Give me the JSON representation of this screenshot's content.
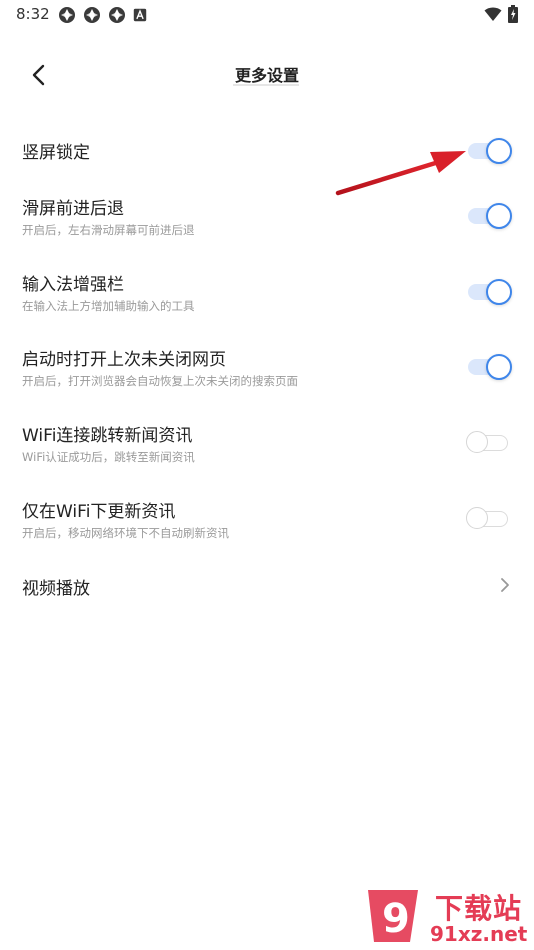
{
  "status_bar": {
    "time": "8:32",
    "notification_icons": [
      "app-notification-icon",
      "app-notification-icon",
      "app-notification-icon",
      "a-notification-icon"
    ],
    "right_icons": [
      "wifi-icon",
      "battery-charging-icon"
    ]
  },
  "header": {
    "title": "更多设置",
    "back_icon": "chevron-left-icon"
  },
  "settings": [
    {
      "title": "竖屏锁定",
      "subtitle": "",
      "enabled": true
    },
    {
      "title": "滑屏前进后退",
      "subtitle": "开启后，左右滑动屏幕可前进后退",
      "enabled": true
    },
    {
      "title": "输入法增强栏",
      "subtitle": "在输入法上方增加辅助输入的工具",
      "enabled": true
    },
    {
      "title": "启动时打开上次未关闭网页",
      "subtitle": "开启后，打开浏览器会自动恢复上次未关闭的搜索页面",
      "enabled": true
    },
    {
      "title": "WiFi连接跳转新闻资讯",
      "subtitle": "WiFi认证成功后，跳转至新闻资讯",
      "enabled": false
    },
    {
      "title": "仅在WiFi下更新资讯",
      "subtitle": "开启后，移动网络环境下不自动刷新资讯",
      "enabled": false
    }
  ],
  "video_row": {
    "title": "视频播放",
    "icon": "chevron-right-icon"
  },
  "colors": {
    "toggle_on": "#3f86ea",
    "toggle_on_track": "#dbe7fb",
    "toggle_off": "#dcdcdc",
    "annotation_arrow": "#d9202a",
    "watermark": "#e43c55"
  },
  "watermark": {
    "logo_text": "9",
    "text": "下载站",
    "url": "91xz.net"
  }
}
